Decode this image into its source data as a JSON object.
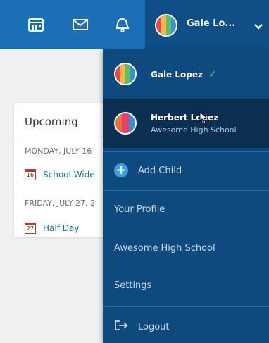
{
  "topbar": {
    "icons": [
      "calendar-icon",
      "envelope-icon",
      "bell-icon"
    ],
    "user_name": "Gale Lo...",
    "colors": {
      "bar": "#1b6fb5",
      "user_zone": "#0f4e86"
    }
  },
  "upcoming": {
    "title": "Upcoming",
    "groups": [
      {
        "date": "MONDAY, JULY 16",
        "event_day": "16",
        "event": "School Wide"
      },
      {
        "date": "FRIDAY, JULY 27, 2",
        "event_day": "27",
        "event": "Half Day"
      }
    ]
  },
  "menu": {
    "users": [
      {
        "name": "Gale Lopez",
        "school": "",
        "selected": true
      },
      {
        "name": "Herbert Lopez",
        "school": "Awesome High School",
        "selected": false
      }
    ],
    "add_child": "Add Child",
    "your_profile": "Your Profile",
    "school": "Awesome High School",
    "settings": "Settings",
    "logout": "Logout",
    "colors": {
      "menu_bg": "#0e4a7d",
      "hover_bg": "#0a2f50",
      "check": "#6cd37b"
    }
  }
}
